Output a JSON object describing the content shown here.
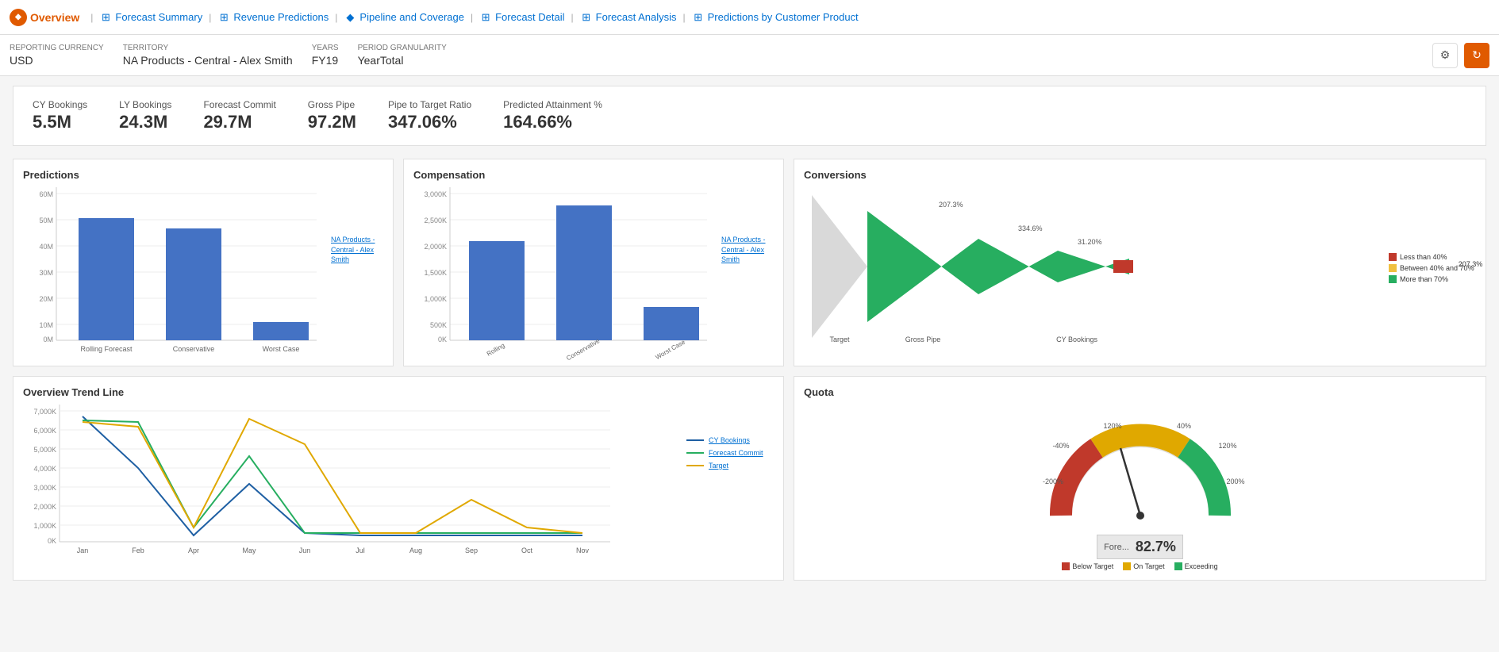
{
  "nav": {
    "brand": "Overview",
    "brand_icon": "◆",
    "items": [
      {
        "label": "Forecast Summary",
        "active": false
      },
      {
        "label": "Revenue Predictions",
        "active": false
      },
      {
        "label": "Pipeline and Coverage",
        "active": false
      },
      {
        "label": "Forecast Detail",
        "active": false
      },
      {
        "label": "Forecast Analysis",
        "active": false
      },
      {
        "label": "Predictions by Customer Product",
        "active": false
      }
    ],
    "separator": "|"
  },
  "filters": {
    "reporting_currency_label": "Reporting Currency",
    "reporting_currency_value": "USD",
    "territory_label": "Territory",
    "territory_value": "NA Products - Central - Alex Smith",
    "years_label": "Years",
    "years_value": "FY19",
    "period_granularity_label": "Period Granularity",
    "period_granularity_value": "YearTotal"
  },
  "kpis": [
    {
      "label": "CY Bookings",
      "value": "5.5M"
    },
    {
      "label": "LY Bookings",
      "value": "24.3M"
    },
    {
      "label": "Forecast Commit",
      "value": "29.7M"
    },
    {
      "label": "Gross Pipe",
      "value": "97.2M"
    },
    {
      "label": "Pipe to Target Ratio",
      "value": "347.06%"
    },
    {
      "label": "Predicted Attainment %",
      "value": "164.66%"
    }
  ],
  "predictions_chart": {
    "title": "Predictions",
    "y_labels": [
      "60M",
      "50M",
      "40M",
      "30M",
      "20M",
      "10M",
      "0M"
    ],
    "bars": [
      {
        "label": "Rolling Forecast",
        "height_pct": 82
      },
      {
        "label": "Conservative",
        "height_pct": 75
      },
      {
        "label": "Worst Case",
        "height_pct": 12
      }
    ],
    "legend_label": "NA Products - Central - Alex Smith"
  },
  "compensation_chart": {
    "title": "Compensation",
    "y_labels": [
      "3,000K",
      "2,500K",
      "2,000K",
      "1,500K",
      "1,000K",
      "500K",
      "0K"
    ],
    "bars": [
      {
        "label": "Rolling\nForecast\nCompensation",
        "height_pct": 65
      },
      {
        "label": "Conservative\nCompensation",
        "height_pct": 88
      },
      {
        "label": "Worst Case\nCompensation",
        "height_pct": 22
      }
    ],
    "legend_label": "NA Products - Central - Alex Smith"
  },
  "conversions_chart": {
    "title": "Conversions",
    "segments": [
      {
        "label": "Target",
        "pct_label": ""
      },
      {
        "label": "Gross Pipe",
        "pct_label": "207.3%"
      },
      {
        "label": "",
        "pct_label": "334.6%"
      },
      {
        "label": "CY Bookings",
        "pct_label": "31.20%"
      }
    ],
    "legend": [
      {
        "label": "Less than 40%",
        "color": "#c0392b"
      },
      {
        "label": "Between 40% and 70%",
        "color": "#f0c040"
      },
      {
        "label": "More than 70%",
        "color": "#27ae60"
      }
    ]
  },
  "trend_chart": {
    "title": "Overview Trend Line",
    "y_labels": [
      "7,000K",
      "6,000K",
      "5,000K",
      "4,000K",
      "3,000K",
      "2,000K",
      "1,000K",
      "0K"
    ],
    "x_labels": [
      "Jan",
      "Feb",
      "Apr",
      "May",
      "Jun",
      "Jul",
      "Aug",
      "Sep",
      "Oct",
      "Nov"
    ],
    "series": [
      {
        "label": "CY Bookings",
        "color": "#1e5fa3"
      },
      {
        "label": "Forecast Commit",
        "color": "#27ae60"
      },
      {
        "label": "Target",
        "color": "#e0a800"
      }
    ]
  },
  "quota_chart": {
    "title": "Quota",
    "value_label": "Fore...",
    "value_pct": "82.7%",
    "gauge_labels": [
      "-40%",
      "40%",
      "120%",
      "120%",
      "-200%",
      "200%"
    ],
    "legend": [
      {
        "label": "Below Target",
        "color": "#c0392b"
      },
      {
        "label": "On Target",
        "color": "#e0a800"
      },
      {
        "label": "Exceeding",
        "color": "#27ae60"
      }
    ]
  }
}
